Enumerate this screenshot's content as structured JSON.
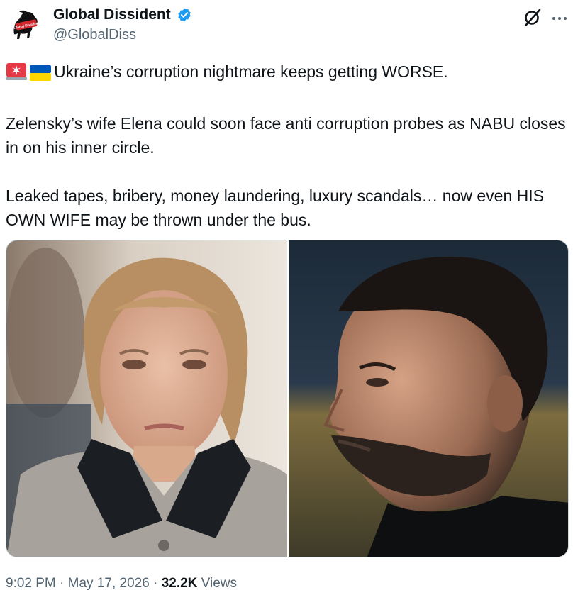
{
  "author": {
    "display_name": "Global Dissident",
    "handle": "@GlobalDiss",
    "verified": true,
    "avatar_text": "Global Dissident"
  },
  "actions": {
    "grok_icon": "grok-icon",
    "more_icon": "more-icon"
  },
  "tweet": {
    "line1": "Ukraine’s corruption nightmare keeps getting WORSE.",
    "line2": "Zelensky’s wife Elena could soon face anti corruption probes as NABU closes in on his inner circle.",
    "line3": "Leaked tapes, bribery, money laundering, luxury scandals… now even HIS OWN WIFE may be thrown under the bus."
  },
  "meta": {
    "time": "9:02 PM",
    "separator1": " · ",
    "date": "May 17, 2026",
    "separator2": " · ",
    "views_count": "32.2K",
    "views_label": " Views"
  },
  "colors": {
    "verified": "#1d9bf0",
    "secondary_text": "#536471",
    "primary_text": "#0f1419"
  }
}
